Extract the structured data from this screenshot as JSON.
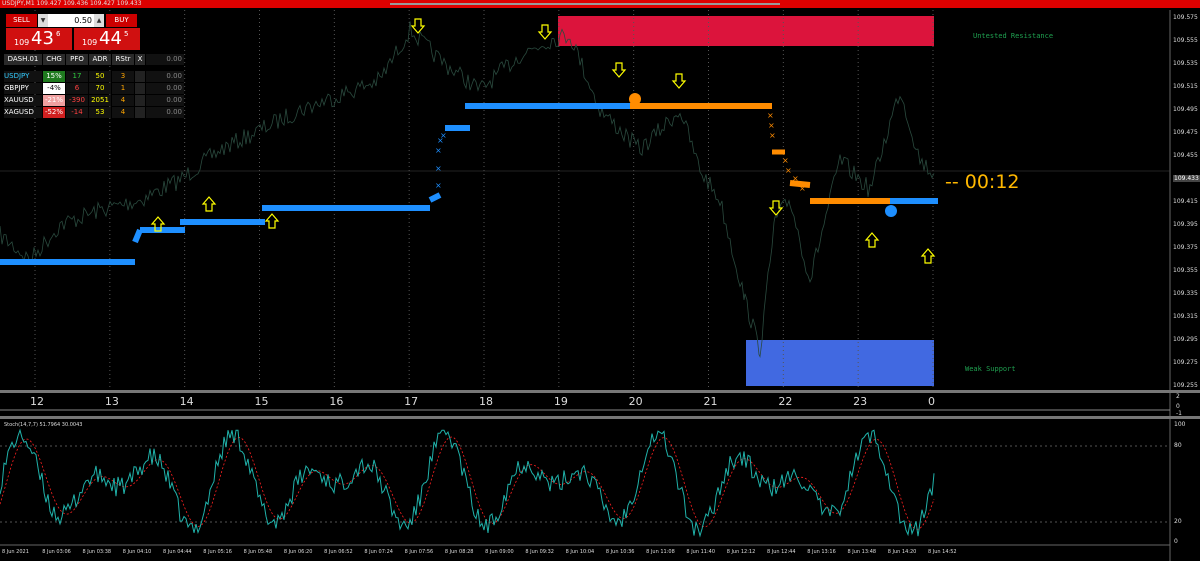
{
  "header": {
    "symbol_line": "USDJPY,M1  109.427 109.436 109.427 109.433"
  },
  "trade_panel": {
    "sell_label": "SELL",
    "buy_label": "BUY",
    "lot_value": "0.50",
    "sell_price": {
      "prefix": "109",
      "big": "43",
      "sup": "6"
    },
    "buy_price": {
      "prefix": "109",
      "big": "44",
      "sup": "5"
    }
  },
  "dashboard": {
    "name": "DASH.01",
    "columns": [
      "CHG",
      "PFO",
      "ADR",
      "RStr",
      "X"
    ],
    "header_value": "0.00",
    "rows": [
      {
        "symbol": "USDJPY",
        "chg": "15%",
        "pfo": "17",
        "adr": "50",
        "rstr": "3",
        "value": "0.00",
        "chg_color": "#1f7a1f",
        "pfo_color": "#2ecc40",
        "symbol_color": "#3cf"
      },
      {
        "symbol": "GBPJPY",
        "chg": "-4%",
        "pfo": "6",
        "adr": "70",
        "rstr": "1",
        "value": "0.00",
        "chg_color": "#ffffff",
        "pfo_color": "#ff4040",
        "symbol_color": "#ffffff"
      },
      {
        "symbol": "XAUUSD",
        "chg": "-21%",
        "pfo": "-390",
        "adr": "2051",
        "rstr": "4",
        "value": "0.00",
        "chg_color": "#f0a0a0",
        "pfo_color": "#ff4040",
        "symbol_color": "#ffffff"
      },
      {
        "symbol": "XAGUSD",
        "chg": "-52%",
        "pfo": "-14",
        "adr": "53",
        "rstr": "4",
        "value": "0.00",
        "chg_color": "#d02020",
        "pfo_color": "#ff4040",
        "symbol_color": "#ffffff"
      }
    ]
  },
  "zones": {
    "resistance_label": "Untested Resistance",
    "support_label": "Weak Support",
    "resistance_color": "#dc143c",
    "support_color": "#4169e1"
  },
  "countdown": "-- 00:12",
  "price_axis": [
    "109.575",
    "109.555",
    "109.535",
    "109.515",
    "109.495",
    "109.475",
    "109.455",
    "109.433",
    "109.415",
    "109.395",
    "109.375",
    "109.355",
    "109.335",
    "109.315",
    "109.295",
    "109.275",
    "109.255"
  ],
  "current_price_index": 7,
  "day_ticks": [
    "12",
    "13",
    "14",
    "15",
    "16",
    "17",
    "18",
    "19",
    "20",
    "21",
    "22",
    "23",
    "0"
  ],
  "stoch": {
    "label": "Stoch(14,7,7) 51.7964 30.0043",
    "levels": [
      "100",
      "80",
      "20",
      "0"
    ]
  },
  "subpanel_axis": [
    "2",
    "0",
    "-1"
  ],
  "time_axis": [
    "8 Jun 2021",
    "8 Jun 03:06",
    "8 Jun 03:38",
    "8 Jun 04:10",
    "8 Jun 04:44",
    "8 Jun 05:16",
    "8 Jun 05:48",
    "8 Jun 06:20",
    "8 Jun 06:52",
    "8 Jun 07:24",
    "8 Jun 07:56",
    "8 Jun 08:28",
    "8 Jun 09:00",
    "8 Jun 09:32",
    "8 Jun 10:04",
    "8 Jun 10:36",
    "8 Jun 11:08",
    "8 Jun 11:40",
    "8 Jun 12:12",
    "8 Jun 12:44",
    "8 Jun 13:16",
    "8 Jun 13:48",
    "8 Jun 14:20",
    "8 Jun 14:52"
  ],
  "colors": {
    "blue_line": "#1e8fff",
    "orange_line": "#ff8c00",
    "arrow": "#ffff00",
    "price_line": "#2a4a3e",
    "stoch_main": "#20b2aa",
    "stoch_signal": "#ff2020"
  }
}
